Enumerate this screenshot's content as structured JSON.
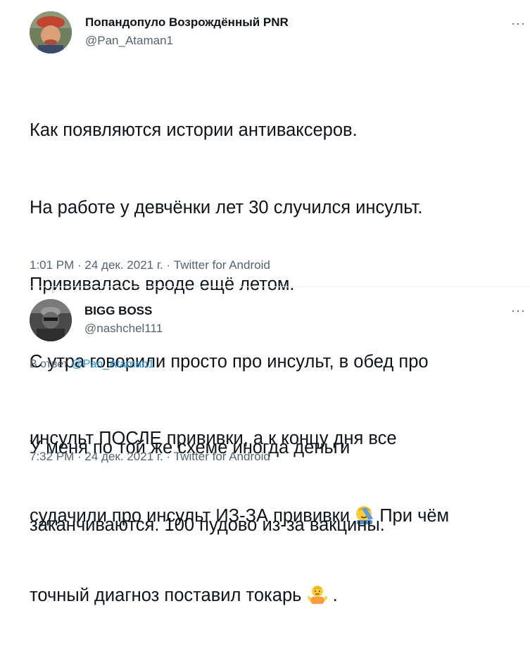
{
  "tweet1": {
    "display_name": "Попандопуло Возрождённый PNR",
    "handle": "@Pan_Ataman1",
    "more_label": "···",
    "lines": [
      "Как появляются истории антиваксеров.",
      "На работе у девчёнки лет 30 случился инсульт.",
      "Прививалась вроде ещё летом.",
      "С утра говорили просто про инсульт, в обед про",
      "инсульт ПОСЛЕ прививки, а к концу дня все"
    ],
    "line6_before": "судачили про инсульт ИЗ-ЗА прививки",
    "line6_after": " При чём",
    "line7_before": "точный диагноз поставил токарь",
    "line7_after": " .",
    "emoji1": "facepalm-emoji",
    "emoji2": "shrug-emoji",
    "meta": "1:01 PM · 24 дек. 2021 г. · Twitter for Android"
  },
  "tweet2": {
    "display_name": "BIGG BOSS",
    "handle": "@nashchel111",
    "more_label": "···",
    "reply_prefix": "В ответ",
    "reply_handle": "@Pan_Ataman1",
    "lines": [
      "У меня по той же схеме иногда деньги",
      "заканчиваются. 100 пудово из-за вакцины."
    ],
    "meta": "7:32 PM · 24 дек. 2021 г. · Twitter for Android"
  },
  "colors": {
    "text": "#0f1419",
    "secondary": "#536471",
    "link": "#1d9bf0",
    "divider": "#eff3f4"
  }
}
